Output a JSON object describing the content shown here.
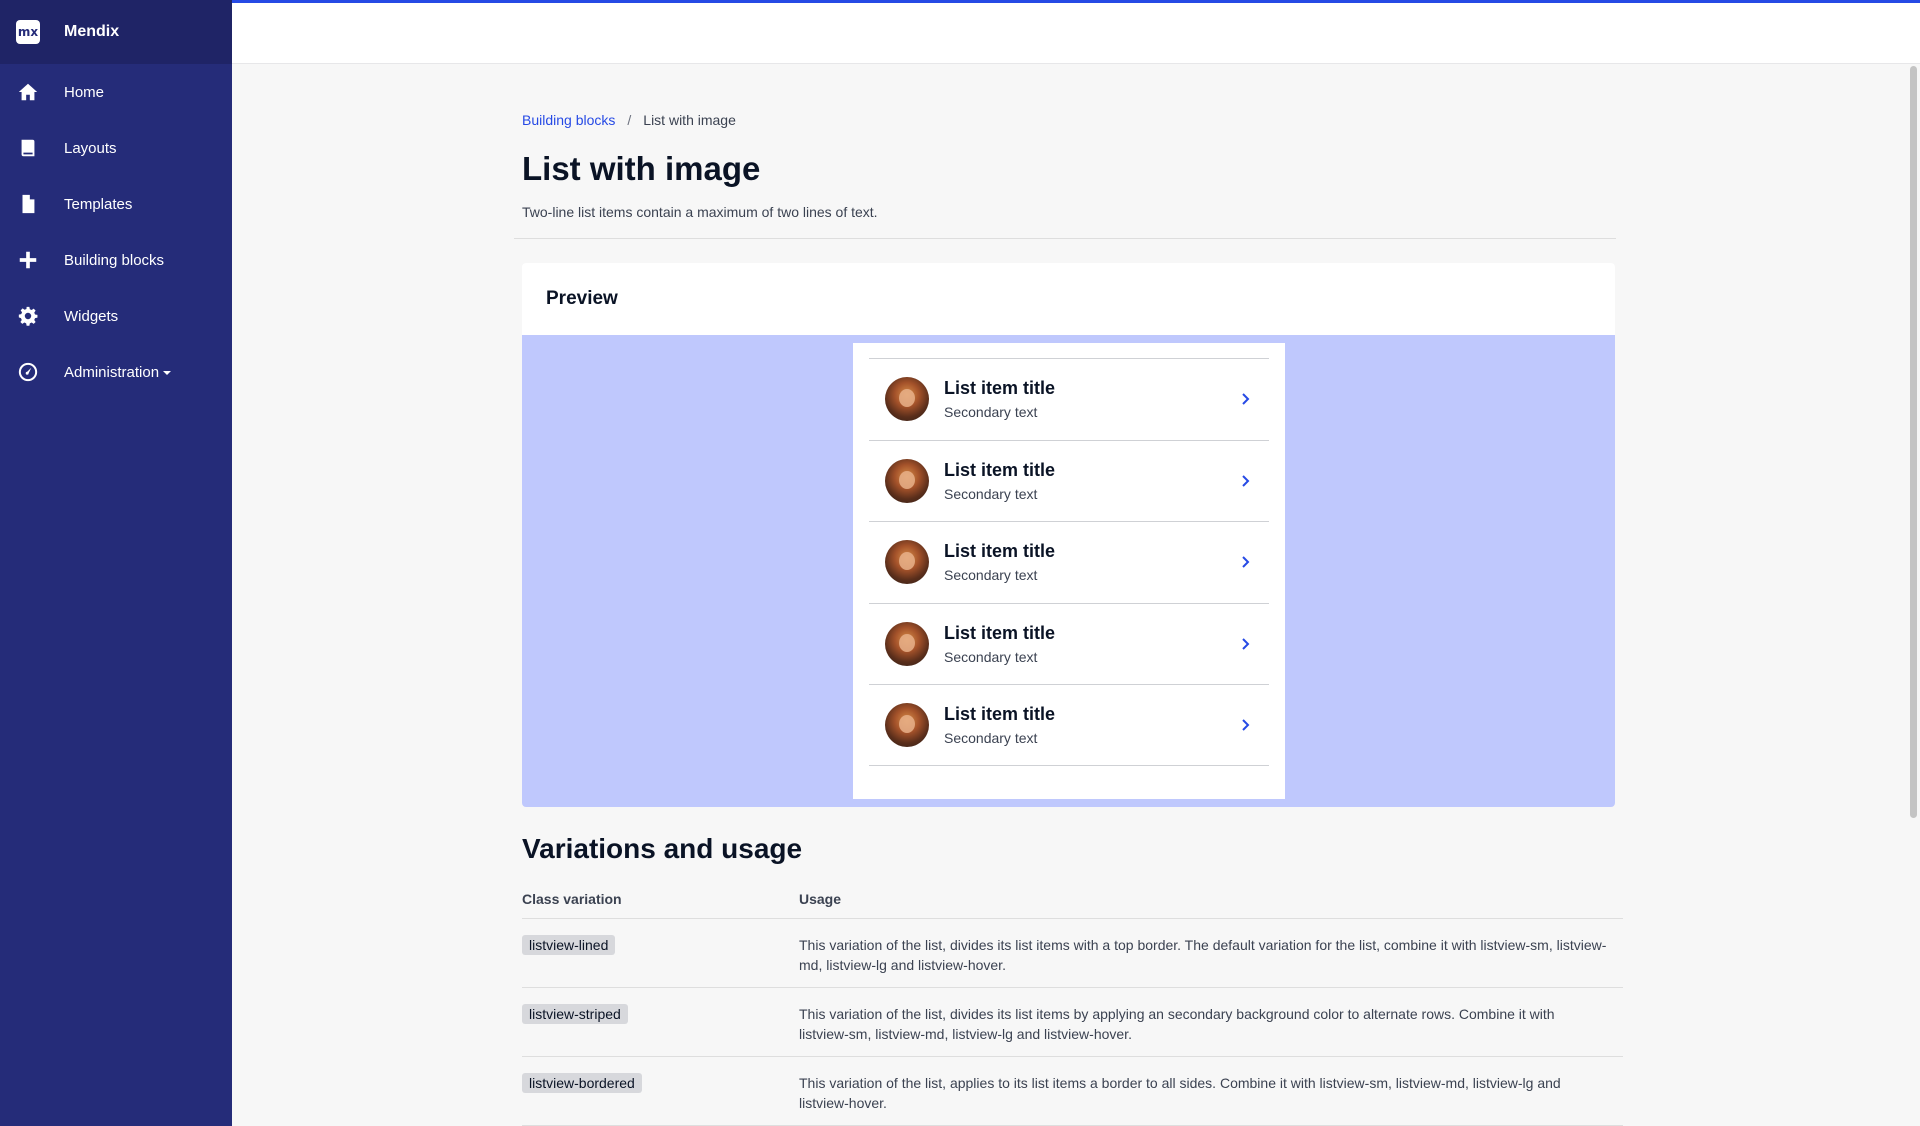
{
  "app": {
    "name": "Mendix",
    "logo_text": "mx"
  },
  "sidebar": {
    "items": [
      {
        "label": "Home",
        "icon": "home-icon"
      },
      {
        "label": "Layouts",
        "icon": "book-icon"
      },
      {
        "label": "Templates",
        "icon": "file-icon"
      },
      {
        "label": "Building blocks",
        "icon": "plus-icon"
      },
      {
        "label": "Widgets",
        "icon": "gear-icon"
      },
      {
        "label": "Administration",
        "icon": "dashboard-icon"
      }
    ]
  },
  "breadcrumb": {
    "parent": "Building blocks",
    "separator": "/",
    "current": "List with image"
  },
  "page": {
    "title": "List with image",
    "subtitle": "Two-line list items contain a maximum of two lines of text."
  },
  "preview": {
    "header": "Preview",
    "items": [
      {
        "title": "List item title",
        "secondary": "Secondary text"
      },
      {
        "title": "List item title",
        "secondary": "Secondary text"
      },
      {
        "title": "List item title",
        "secondary": "Secondary text"
      },
      {
        "title": "List item title",
        "secondary": "Secondary text"
      },
      {
        "title": "List item title",
        "secondary": "Secondary text"
      }
    ]
  },
  "variations": {
    "title": "Variations and usage",
    "columns": [
      "Class variation",
      "Usage"
    ],
    "rows": [
      {
        "class": "listview-lined",
        "usage": "This variation of the list, divides its list items with a top border. The default variation for the list, combine it with listview-sm, listview-md, listview-lg and listview-hover."
      },
      {
        "class": "listview-striped",
        "usage": "This variation of the list, divides its list items by applying an secondary background color to alternate rows. Combine it with listview-sm, listview-md, listview-lg and listview-hover."
      },
      {
        "class": "listview-bordered",
        "usage": "This variation of the list, applies to its list items a border to all sides. Combine it with listview-sm, listview-md, listview-lg and listview-hover."
      }
    ]
  },
  "colors": {
    "sidebar": "#252c79",
    "accent": "#264ae5",
    "preview_bg": "#bfc8fd"
  }
}
